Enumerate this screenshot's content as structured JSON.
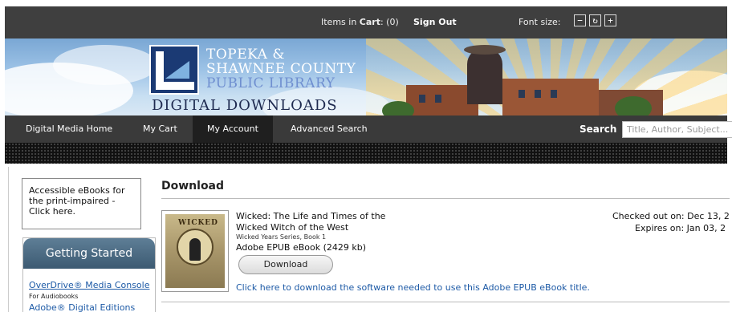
{
  "topbar": {
    "cart_label": "Items in",
    "cart_bold": "Cart",
    "cart_count": ": (0)",
    "sign_out": "Sign Out",
    "font_size_label": "Font size:",
    "font_decrease": "−",
    "font_reset": "↻",
    "font_increase": "+"
  },
  "banner": {
    "logo_line1": "TOPEKA &",
    "logo_line2": "SHAWNEE COUNTY",
    "logo_line3": "PUBLIC LIBRARY",
    "logo_line4": "DIGITAL DOWNLOADS"
  },
  "nav": {
    "items": [
      "Digital Media Home",
      "My Cart",
      "My Account",
      "Advanced Search"
    ],
    "search_label": "Search",
    "search_placeholder": "Title, Author, Subject..."
  },
  "sidebar": {
    "accessible_text": "Accessible eBooks for the print-impaired - Click here.",
    "getting_started": "Getting Started",
    "links": [
      {
        "label": "OverDrive® Media Console",
        "sub": "For Audiobooks"
      },
      {
        "label": "Adobe® Digital Editions",
        "sub": ""
      }
    ]
  },
  "main": {
    "title": "Download",
    "book": {
      "cover_text": "WICKED",
      "title": "Wicked: The Life and Times of the Wicked Witch of the West",
      "series": "Wicked Years Series, Book 1",
      "format": "Adobe EPUB eBook (2429 kb)",
      "download_label": "Download",
      "help_text": "Click here to download the software needed to use this Adobe EPUB eBook title.",
      "checked_out": "Checked out on:  Dec 13, 2",
      "expires": "Expires on:  Jan 03, 2"
    }
  }
}
